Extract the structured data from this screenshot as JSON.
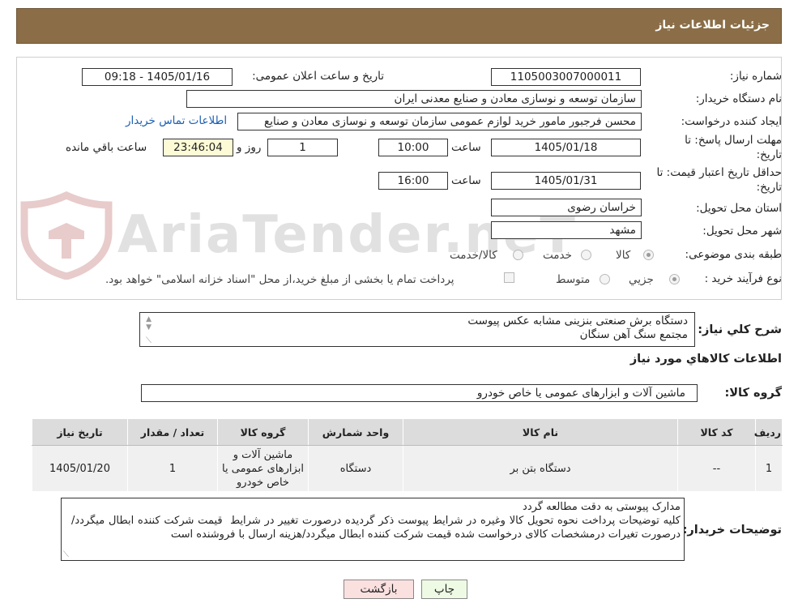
{
  "header": {
    "title": "جزئیات اطلاعات نیاز"
  },
  "fields": {
    "need_number": {
      "label": "شماره نیاز:",
      "value": "1105003007000011"
    },
    "announce": {
      "label": "تاریخ و ساعت اعلان عمومی:",
      "value": "1405/01/16 - 09:18"
    },
    "buyer_org": {
      "label": "نام دستگاه خریدار:",
      "value": "سازمان توسعه و نوسازی معادن و صنایع معدنی ایران"
    },
    "requester": {
      "label": "ایجاد کننده درخواست:",
      "value": "محسن فرجبور مامور خرید لوازم عمومی سازمان توسعه و نوسازی معادن و صنایع"
    },
    "contact_link": "اطلاعات تماس خریدار",
    "deadline": {
      "label_line1": "مهلت ارسال پاسخ: تا",
      "label_line2": "تاریخ:",
      "date": "1405/01/18",
      "time_label": "ساعت",
      "time": "10:00",
      "days": "1",
      "days_label": "روز و",
      "remaining": "23:46:04",
      "remaining_label": "ساعت باقي مانده"
    },
    "validity": {
      "label_line1": "حداقل تاریخ اعتبار قیمت: تا",
      "label_line2": "تاریخ:",
      "date": "1405/01/31",
      "time_label": "ساعت",
      "time": "16:00"
    },
    "province": {
      "label": "استان محل تحویل:",
      "value": "خراسان رضوی"
    },
    "city": {
      "label": "شهر محل تحویل:",
      "value": "مشهد"
    },
    "category": {
      "label": "طبقه بندی موضوعی:",
      "options": [
        "کالا",
        "خدمت",
        "کالا/خدمت"
      ],
      "selected": "کالا"
    },
    "process": {
      "label": "نوع فرآیند خرید :",
      "options": [
        "جزیي",
        "متوسط"
      ],
      "selected": "جزیي",
      "payment_note": "پرداخت تمام یا بخشی از مبلغ خرید،از محل \"اسناد خزانه اسلامی\" خواهد بود."
    }
  },
  "watermark": {
    "text": "AriaTender.neT"
  },
  "summary": {
    "label": "شرح کلي نیاز:",
    "lines": [
      "دستگاه برش صنعتی بنزینی مشابه عکس پیوست",
      "مجتمع سنگ آهن سنگان"
    ]
  },
  "goods_section": {
    "title": "اطلاعات کالاهاي مورد نیاز",
    "group_label": "گروه کالا:",
    "group_value": "ماشین آلات و ابزارهای عمومی یا خاص خودرو"
  },
  "table": {
    "headers": [
      "ردیف",
      "کد کالا",
      "نام کالا",
      "واحد شمارش",
      "گروه کالا",
      "تعداد / مقدار",
      "تاریخ نیاز"
    ],
    "rows": [
      [
        "1",
        "--",
        "دستگاه بتن بر",
        "دستگاه",
        "ماشین آلات و ابزارهای عمومی یا خاص خودرو",
        "1",
        "1405/01/20"
      ]
    ]
  },
  "buyer_notes": {
    "label": "توضیحات خریدار:",
    "text": "مدارک پیوستی به دقت مطالعه گردد\nکلیه توضیحات پرداخت نحوه تحویل کالا وغیره در شرایط پیوست ذکر گردیده درصورت تغییر در شرایط  قیمت شرکت کننده ابطال میگردد/درصورت تغیرات درمشخصات کالای درخواست شده قیمت شرکت کننده ابطال میگردد/هزینه ارسال با فروشنده است"
  },
  "buttons": {
    "print": "چاپ",
    "back": "بازگشت"
  }
}
